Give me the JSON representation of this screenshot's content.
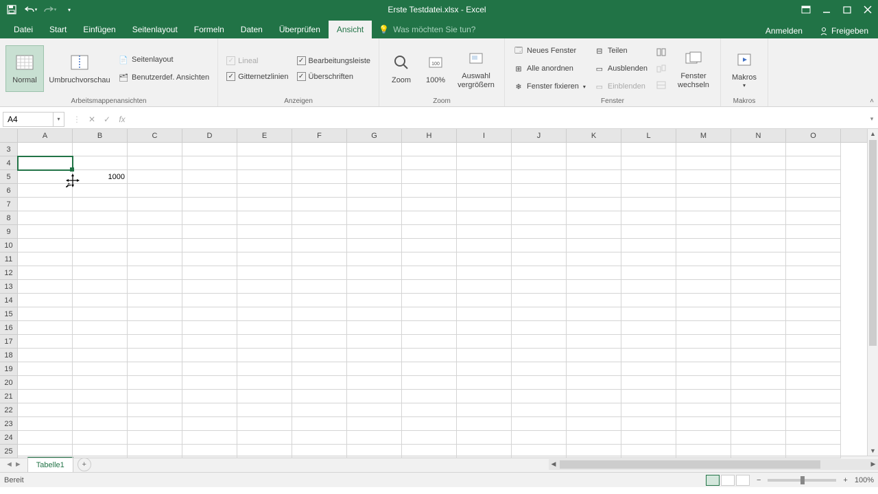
{
  "titlebar": {
    "title": "Erste Testdatei.xlsx - Excel"
  },
  "tabs": {
    "datei": "Datei",
    "start": "Start",
    "einfuegen": "Einfügen",
    "seitenlayout": "Seitenlayout",
    "formeln": "Formeln",
    "daten": "Daten",
    "ueberpruefen": "Überprüfen",
    "ansicht": "Ansicht",
    "tellme_placeholder": "Was möchten Sie tun?",
    "anmelden": "Anmelden",
    "freigeben": "Freigeben"
  },
  "ribbon": {
    "g1": {
      "normal": "Normal",
      "umbruch": "Umbruchvorschau",
      "seitenlayout": "Seitenlayout",
      "benutzer": "Benutzerdef. Ansichten",
      "label": "Arbeitsmappenansichten"
    },
    "g2": {
      "lineal": "Lineal",
      "gitter": "Gitternetzlinien",
      "bearb": "Bearbeitungsleiste",
      "ueber": "Überschriften",
      "label": "Anzeigen"
    },
    "g3": {
      "zoom": "Zoom",
      "hundert": "100%",
      "auswahl": "Auswahl vergrößern",
      "label": "Zoom"
    },
    "g4": {
      "neues": "Neues Fenster",
      "alle": "Alle anordnen",
      "fixieren": "Fenster fixieren",
      "teilen": "Teilen",
      "ausblenden": "Ausblenden",
      "einblenden": "Einblenden",
      "wechseln": "Fenster wechseln",
      "label": "Fenster"
    },
    "g5": {
      "makros": "Makros",
      "label": "Makros"
    }
  },
  "namebox": {
    "value": "A4"
  },
  "formula": {
    "value": ""
  },
  "columns": [
    "A",
    "B",
    "C",
    "D",
    "E",
    "F",
    "G",
    "H",
    "I",
    "J",
    "K",
    "L",
    "M",
    "N",
    "O"
  ],
  "rows": [
    3,
    4,
    5,
    6,
    7,
    8,
    9,
    10,
    11,
    12,
    13,
    14,
    15,
    16,
    17,
    18,
    19,
    20,
    21,
    22,
    23,
    24,
    25
  ],
  "cells": {
    "B5": "1000"
  },
  "selected": "A4",
  "sheet": {
    "nav_prev": "◄",
    "nav_next": "►",
    "tab1": "Tabelle1",
    "add": "+"
  },
  "status": {
    "ready": "Bereit",
    "zoom": "100%"
  }
}
